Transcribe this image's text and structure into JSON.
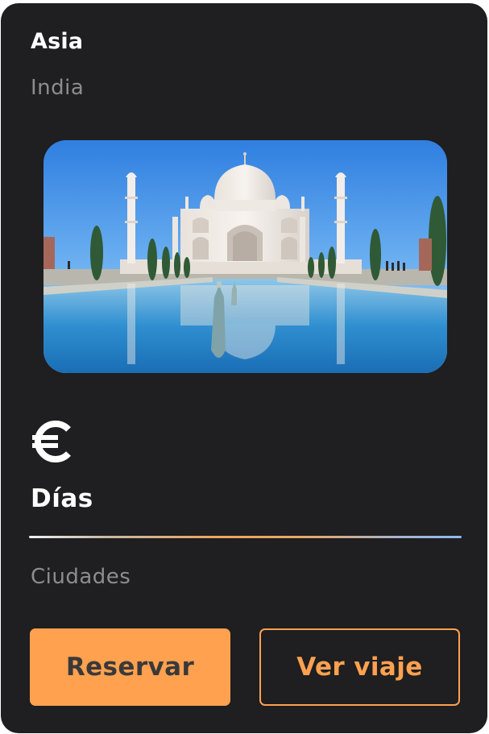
{
  "card": {
    "region": "Asia",
    "country": "India",
    "image": {
      "subject": "Taj Mahal"
    },
    "price_icon": "euro-icon",
    "days_label": "Días",
    "cities_label": "Ciudades",
    "actions": {
      "reserve_label": "Reservar",
      "view_trip_label": "Ver viaje"
    }
  },
  "colors": {
    "card_background": "#1f1e20",
    "accent": "#ffa14f",
    "muted_text": "#8d8c8e",
    "primary_text": "#ffffff",
    "divider_end": "#8eb9f2"
  }
}
